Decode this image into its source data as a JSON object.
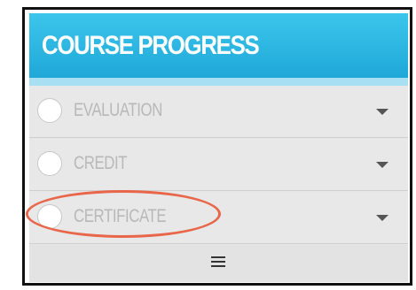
{
  "header": {
    "title": "COURSE PROGRESS"
  },
  "rows": [
    {
      "label": "EVALUATION",
      "icon": "radio-circle-icon",
      "expand_icon": "caret-down-icon"
    },
    {
      "label": "CREDIT",
      "icon": "radio-circle-icon",
      "expand_icon": "caret-down-icon"
    },
    {
      "label": "CERTIFICATE",
      "icon": "radio-circle-icon",
      "expand_icon": "caret-down-icon"
    }
  ],
  "footer": {
    "icon": "hamburger-menu-icon"
  },
  "colors": {
    "header_bg": "#29b6e4",
    "header_stripe": "#a9dff2",
    "row_bg": "#e8e8e8",
    "label_text": "#b8b8b8",
    "annotation": "#e8664a"
  }
}
